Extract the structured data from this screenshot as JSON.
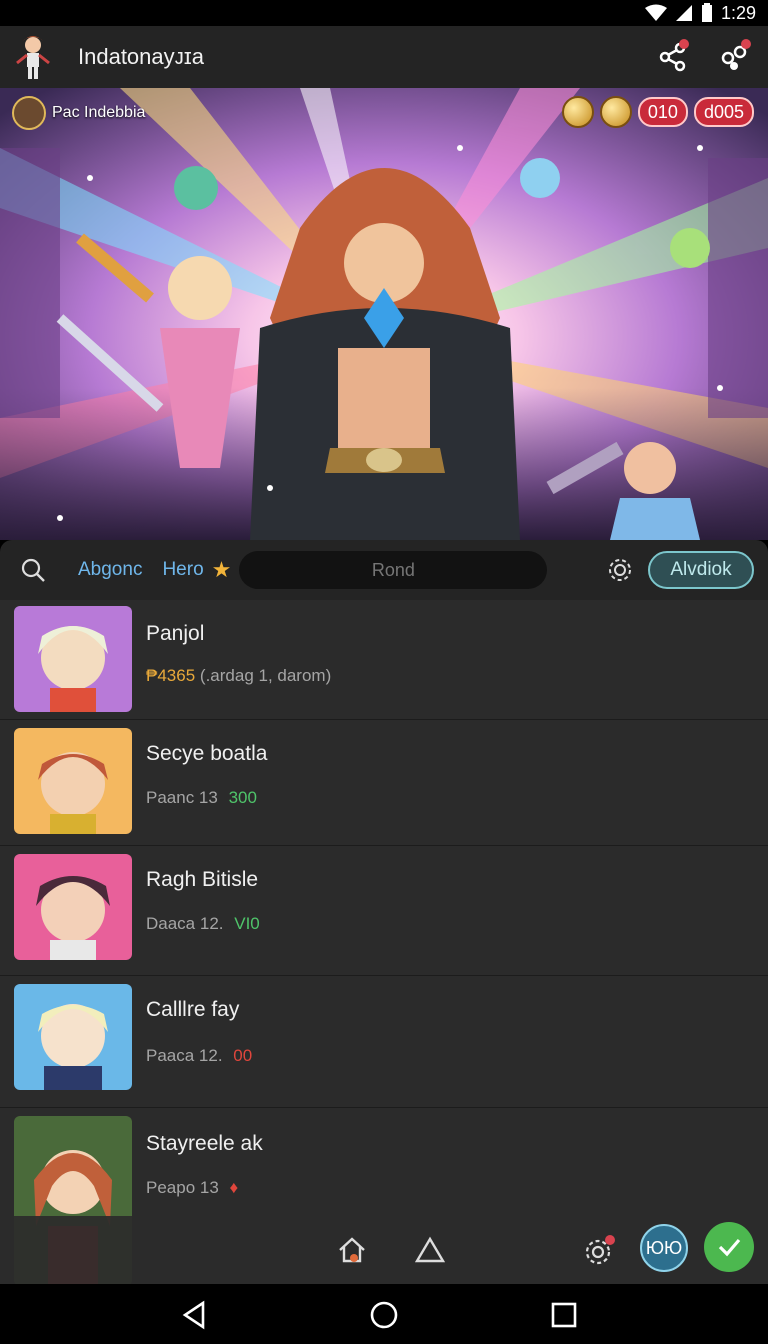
{
  "status_bar": {
    "time": "1:29"
  },
  "app_bar": {
    "title": "Indatonayᴊɪa"
  },
  "hero": {
    "user_label": "Pac Indebbia",
    "badges": [
      "010",
      "d005"
    ]
  },
  "toolbar": {
    "tab_primary": "Abgonc",
    "tab_secondary": "Hero",
    "search_placeholder": "Rond",
    "action_label": "Alvdiok"
  },
  "list": {
    "items": [
      {
        "title": "Panjol",
        "sub_prefix": "",
        "sub_value": "₱4365",
        "sub_suffix": "(.ardag 1, darom)",
        "value_color": "#e9a93a"
      },
      {
        "title": "Seсye boatla",
        "sub_prefix": "Paanc 13",
        "sub_value": "300",
        "sub_suffix": "",
        "value_color": "#4fc46a"
      },
      {
        "title": "Ragh Bitisle",
        "sub_prefix": "Daaca 12.",
        "sub_value": "VI0",
        "sub_suffix": "",
        "value_color": "#4fc46a"
      },
      {
        "title": "Calllre fay",
        "sub_prefix": "Paaca 12.",
        "sub_value": "00",
        "sub_suffix": "",
        "value_color": "#e0463c"
      },
      {
        "title": "Stayreele ak",
        "sub_prefix": "Peapo 13",
        "sub_value": "♦",
        "sub_suffix": "",
        "value_color": "#e0463c"
      }
    ]
  },
  "bottom_actions": {
    "round_label": "ЮЮ"
  },
  "icons": {
    "search": "search-icon",
    "share": "share-icon",
    "settings": "settings-icon",
    "home": "home-icon",
    "back": "back-icon",
    "overview": "overview-icon"
  },
  "colors": {
    "accent_blue": "#6fb6ea",
    "accent_teal": "#7cc6cc",
    "success": "#4cb84f",
    "badge_red": "#c92a3a"
  }
}
